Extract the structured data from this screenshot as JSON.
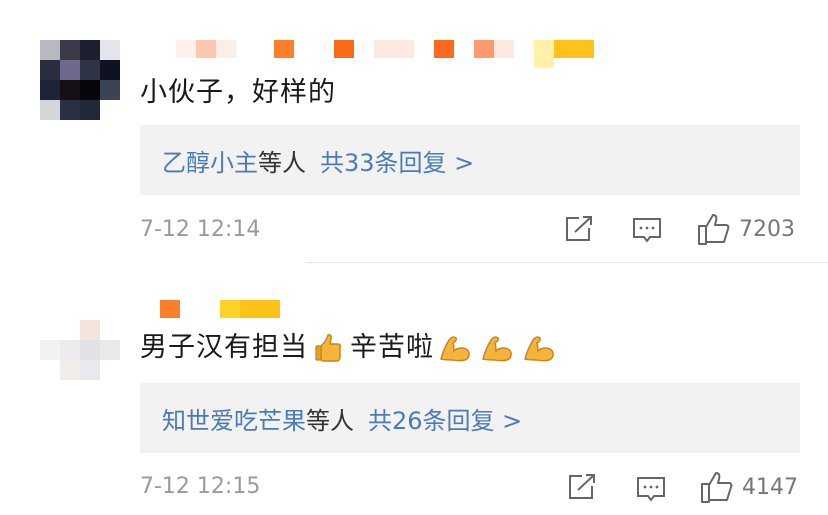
{
  "comments": [
    {
      "text": "小伙子，好样的",
      "reply_names": "乙醇小主",
      "reply_suffix": "等人",
      "reply_count": "共33条回复 >",
      "time": "7-12 12:14",
      "likes": "7203"
    },
    {
      "text_main": "男子汉有担当",
      "text_after": "辛苦啦",
      "reply_names": "知世爱吃芒果",
      "reply_suffix": "等人",
      "reply_count": "共26条回复 >",
      "time": "7-12 12:15",
      "likes": "4147"
    }
  ],
  "icons": [
    "share-icon",
    "comment-icon",
    "like-thumb-icon",
    "thumbs-up-emoji-icon",
    "flexed-biceps-emoji-icon"
  ],
  "colors": {
    "reply_link": "#4a7bb6",
    "reply_bg": "#f2f2f2",
    "meta_text": "#9a9a9a"
  }
}
